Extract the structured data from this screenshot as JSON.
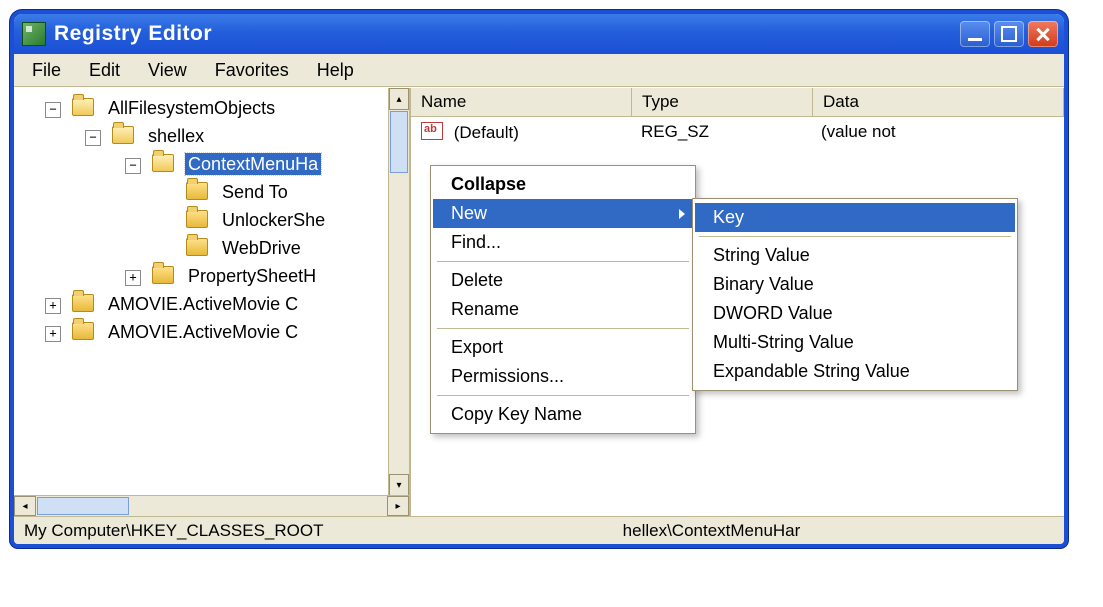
{
  "window": {
    "title": "Registry Editor"
  },
  "menubar": {
    "items": [
      "File",
      "Edit",
      "View",
      "Favorites",
      "Help"
    ]
  },
  "tree": {
    "allfs": "AllFilesystemObjects",
    "shellex": "shellex",
    "ctxmh": "ContextMenuHa",
    "sendto": "Send To",
    "unlocker": "UnlockerShe",
    "webdrive": "WebDrive",
    "propsheet": "PropertySheetH",
    "amovie1": "AMOVIE.ActiveMovie C",
    "amovie2": "AMOVIE.ActiveMovie C"
  },
  "listview": {
    "cols": {
      "name": "Name",
      "type": "Type",
      "data": "Data"
    },
    "row0": {
      "name": "(Default)",
      "type": "REG_SZ",
      "data": "(value not"
    }
  },
  "statusbar": "My Computer\\HKEY_CLASSES_ROOT",
  "status_tail": "hellex\\ContextMenuHar",
  "ctxmenu": {
    "collapse": "Collapse",
    "new": "New",
    "find": "Find...",
    "delete": "Delete",
    "rename": "Rename",
    "export": "Export",
    "permissions": "Permissions...",
    "copykey": "Copy Key Name"
  },
  "newmenu": {
    "key": "Key",
    "string": "String Value",
    "binary": "Binary Value",
    "dword": "DWORD Value",
    "multistr": "Multi-String Value",
    "expstr": "Expandable String Value"
  }
}
